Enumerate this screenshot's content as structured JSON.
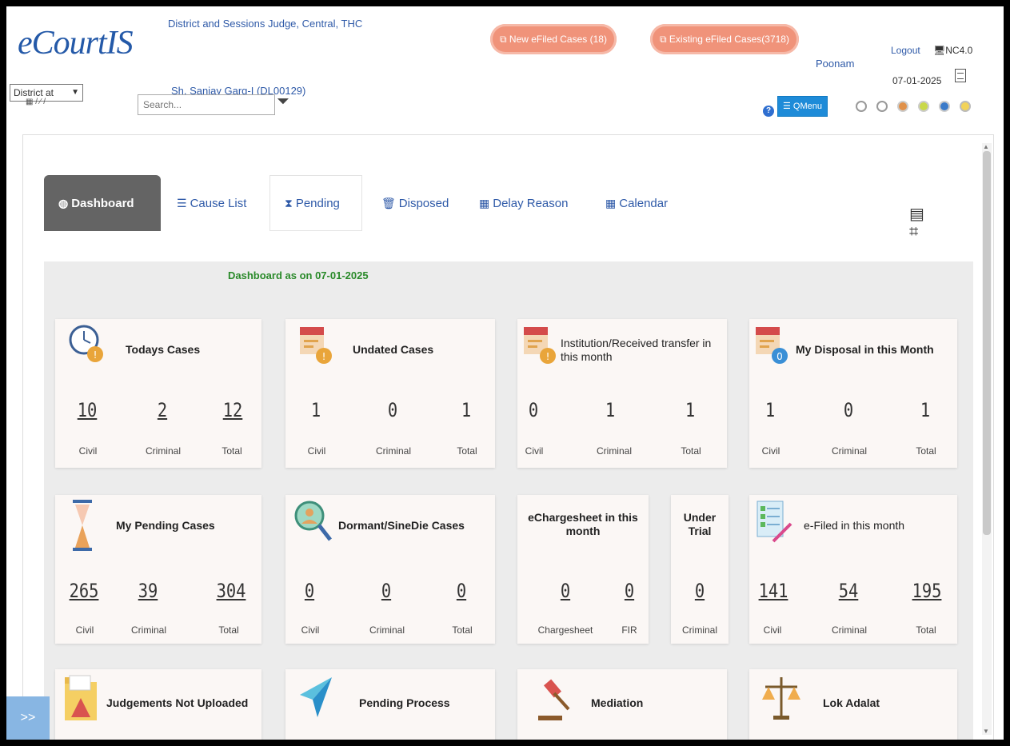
{
  "header": {
    "logo": "eCourtIS",
    "court_name": "District and Sessions Judge, Central, THC",
    "judge_name": "Sh. Sanjay Garg-I (DL00129)",
    "new_efiled": "New eFiled Cases (18)",
    "existing_efiled": "Existing eFiled Cases(3718)",
    "user": "Poonam",
    "logout": "Logout",
    "version": "NC4.0",
    "date": "07-01-2025",
    "district_select": "District at",
    "search_placeholder": "Search...",
    "menu_button": "☰ QMenu",
    "theme_dots": [
      "#ffffff",
      "#ffffff",
      "#e0914a",
      "#c9d84a",
      "#3a7ac9",
      "#f2d35a"
    ]
  },
  "tabs": [
    {
      "label": "Dashboard",
      "icon": "dashboard-icon"
    },
    {
      "label": "Cause List",
      "icon": "list-icon"
    },
    {
      "label": "Pending",
      "icon": "hourglass-icon"
    },
    {
      "label": "Disposed",
      "icon": "trash-icon"
    },
    {
      "label": "Delay Reason",
      "icon": "calendar-icon"
    },
    {
      "label": "Calendar",
      "icon": "calendar-icon"
    }
  ],
  "dashboard": {
    "title": "Dashboard as on 07-01-2025",
    "cards": {
      "todays": {
        "title": "Todays Cases",
        "values": [
          "10",
          "2",
          "12"
        ],
        "labels": [
          "Civil",
          "Criminal",
          "Total"
        ]
      },
      "undated": {
        "title": "Undated Cases",
        "values": [
          "1",
          "0",
          "1"
        ],
        "labels": [
          "Civil",
          "Criminal",
          "Total"
        ]
      },
      "institution": {
        "title": "Institution/Received transfer in this month",
        "values": [
          "0",
          "1",
          "1"
        ],
        "labels": [
          "Civil",
          "Criminal",
          "Total"
        ]
      },
      "disposal": {
        "title": "My Disposal in this Month",
        "values": [
          "1",
          "0",
          "1"
        ],
        "labels": [
          "Civil",
          "Criminal",
          "Total"
        ]
      },
      "pending": {
        "title": "My Pending Cases",
        "values": [
          "265",
          "39",
          "304"
        ],
        "labels": [
          "Civil",
          "Criminal",
          "Total"
        ]
      },
      "dormant": {
        "title": "Dormant/SineDie Cases",
        "values": [
          "0",
          "0",
          "0"
        ],
        "labels": [
          "Civil",
          "Criminal",
          "Total"
        ]
      },
      "echargesheet": {
        "title": "eChargesheet in this month",
        "values": [
          "0",
          "0"
        ],
        "labels": [
          "Chargesheet",
          "FIR"
        ]
      },
      "undertrial": {
        "title": "Under Trial",
        "values": [
          "0"
        ],
        "labels": [
          "Criminal"
        ]
      },
      "efiled": {
        "title": "e-Filed in this month",
        "values": [
          "141",
          "54",
          "195"
        ],
        "labels": [
          "Civil",
          "Criminal",
          "Total"
        ]
      },
      "judgements": {
        "title": "Judgements Not Uploaded"
      },
      "process": {
        "title": "Pending Process"
      },
      "mediation": {
        "title": "Mediation"
      },
      "lokadalat": {
        "title": "Lok Adalat"
      }
    }
  }
}
